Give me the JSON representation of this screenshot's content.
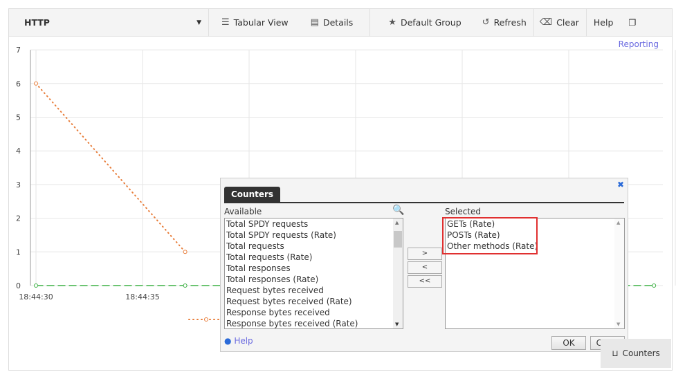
{
  "toolbar": {
    "group": "HTTP",
    "tabular_view": "Tabular View",
    "details": "Details",
    "default_group": "Default Group",
    "refresh": "Refresh",
    "clear": "Clear",
    "help": "Help"
  },
  "reporting_link": "Reporting",
  "chart_data": {
    "type": "line",
    "ylim": [
      0,
      7
    ],
    "yticks": [
      "0",
      "1",
      "2",
      "3",
      "4",
      "5",
      "6",
      "7"
    ],
    "xticks": [
      "18:44:30",
      "18:44:35"
    ],
    "grid": true,
    "series": [
      {
        "color": "#e87d3a",
        "style": "dotted",
        "points": [
          [
            "18:44:30",
            6
          ],
          [
            "18:44:37",
            1
          ]
        ]
      },
      {
        "color": "#3cb043",
        "style": "dashed",
        "points": [
          [
            "18:44:30",
            0
          ],
          [
            "18:44:37",
            0
          ],
          [
            "18:44:59",
            0
          ]
        ]
      }
    ]
  },
  "dialog": {
    "tab": "Counters",
    "available_label": "Available",
    "selected_label": "Selected",
    "available": [
      "Total SPDY requests",
      "Total SPDY requests (Rate)",
      "Total requests",
      "Total requests (Rate)",
      "Total responses",
      "Total responses (Rate)",
      "Request bytes received",
      "Request bytes received (Rate)",
      "Response bytes received",
      "Response bytes received (Rate)"
    ],
    "selected": [
      "GETs (Rate)",
      "POSTs (Rate)",
      "Other methods (Rate)"
    ],
    "add": ">",
    "remove": "<",
    "remove_all": "<<",
    "help": "Help",
    "ok": "OK",
    "close": "Close"
  },
  "counters_button": "Counters"
}
